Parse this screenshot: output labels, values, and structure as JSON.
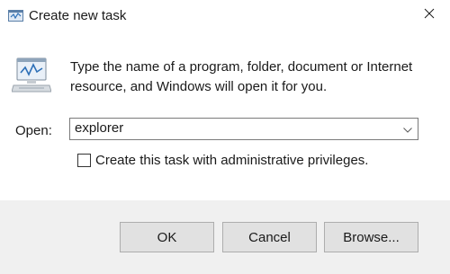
{
  "window": {
    "title": "Create new task",
    "title_icon": "run-dialog-icon",
    "close_icon": "close-icon"
  },
  "content": {
    "app_icon": "run-program-icon",
    "message": "Type the name of a program, folder, document or Internet resource, and Windows will open it for you.",
    "open_label": "Open:",
    "open_value": "explorer",
    "dropdown_icon": "chevron-down-icon",
    "admin_checkbox": {
      "label": "Create this task with administrative privileges.",
      "checked": false
    }
  },
  "buttons": {
    "ok": "OK",
    "cancel": "Cancel",
    "browse": "Browse..."
  },
  "colors": {
    "footer_background": "#f0f0f0",
    "button_background": "#e1e1e1",
    "button_border": "#adadad",
    "field_border": "#7a7a7a"
  }
}
